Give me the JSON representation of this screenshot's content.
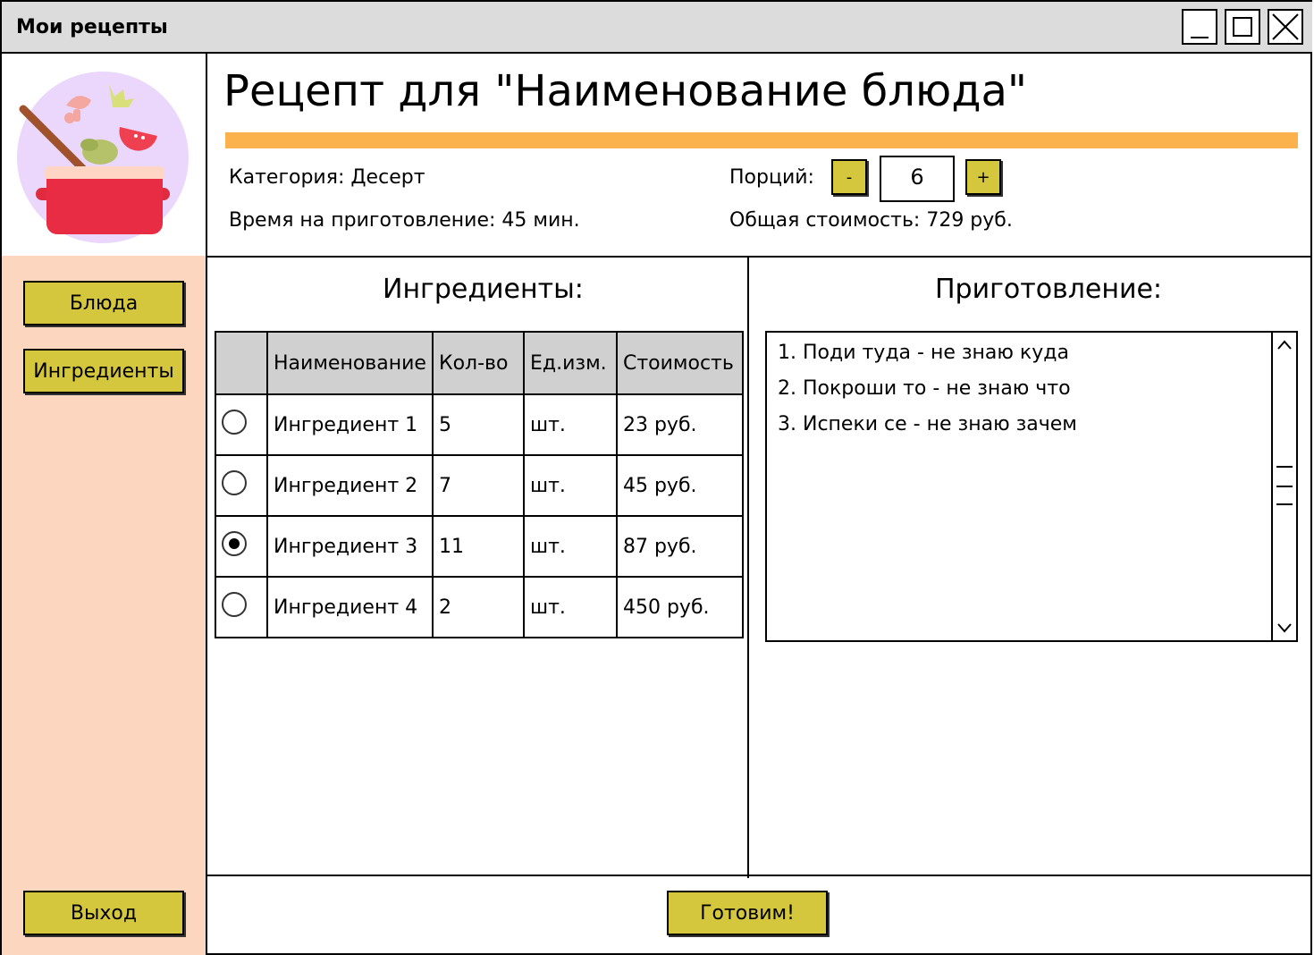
{
  "window": {
    "title": "Мои рецепты"
  },
  "sidebar": {
    "items": [
      {
        "label": "Блюда"
      },
      {
        "label": "Ингредиенты"
      }
    ],
    "exit_label": "Выход"
  },
  "header": {
    "title": "Рецепт для \"Наименование блюда\"",
    "category": "Категория: Десерт",
    "time": "Время на приготовление: 45 мин.",
    "portions_label": "Порций:",
    "minus_label": "-",
    "plus_label": "+",
    "portions_value": "6",
    "total_cost": "Общая стоимость: 729 руб."
  },
  "ingredients": {
    "title": "Ингредиенты:",
    "columns": [
      "",
      "Наименование",
      "Кол-во",
      "Ед.изм.",
      "Стоимость"
    ],
    "rows": [
      {
        "selected": false,
        "name": "Ингредиент 1",
        "qty": "5",
        "unit": "шт.",
        "cost": "23 руб."
      },
      {
        "selected": false,
        "name": "Ингредиент 2",
        "qty": "7",
        "unit": "шт.",
        "cost": "45 руб."
      },
      {
        "selected": true,
        "name": "Ингредиент 3",
        "qty": "11",
        "unit": "шт.",
        "cost": "87 руб."
      },
      {
        "selected": false,
        "name": "Ингредиент 4",
        "qty": "2",
        "unit": "шт.",
        "cost": "450 руб."
      }
    ]
  },
  "preparation": {
    "title": "Приготовление:",
    "steps": [
      "1. Поди туда - не знаю куда",
      "2. Покроши то - не знаю что",
      "3. Испеки се - не знаю зачем"
    ]
  },
  "footer": {
    "cook_label": "Готовим!"
  },
  "colors": {
    "button": "#d4c73e",
    "sidebar_bg": "#fdd6c0",
    "title_accent": "#fbb14c",
    "titlebar_bg": "#dcdcdc"
  }
}
